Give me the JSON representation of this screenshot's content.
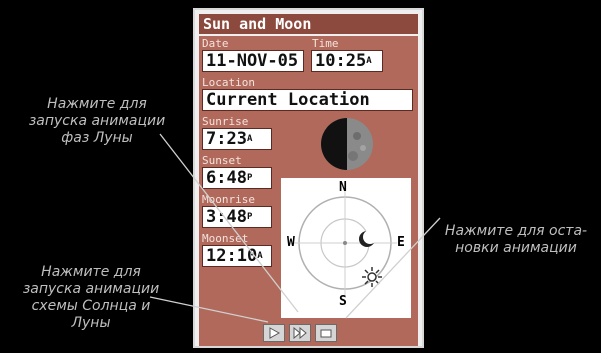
{
  "window": {
    "title": "Sun and Moon"
  },
  "fields": {
    "date_label": "Date",
    "date_value": "11-NOV-05",
    "time_label": "Time",
    "time_value": "10:25",
    "time_ampm": "A",
    "location_label": "Location",
    "location_value": "Current Location",
    "sunrise_label": "Sunrise",
    "sunrise_value": "7:23",
    "sunrise_ampm": "A",
    "sunset_label": "Sunset",
    "sunset_value": "6:48",
    "sunset_ampm": "P",
    "moonrise_label": "Moonrise",
    "moonrise_value": "3:48",
    "moonrise_ampm": "P",
    "moonset_label": "Moonset",
    "moonset_value": "12:10",
    "moonset_ampm": "A"
  },
  "compass": {
    "n": "N",
    "s": "S",
    "e": "E",
    "w": "W"
  },
  "buttons": {
    "play_icon": "play-icon",
    "fast_forward_icon": "fast-forward-icon",
    "stop_icon": "stop-icon"
  },
  "callouts": {
    "moon_phase_animation": "Нажмите для\nзапуска анимации\nфаз Луны",
    "stop_animation": "Нажмите для оста-\nновки анимации",
    "sun_moon_animation": "Нажмите для\nзапуска анимации\nсхемы Солнца и\nЛуны"
  },
  "colors": {
    "title_bar": "#8c4a3e",
    "panel": "#b0695a",
    "callout_text": "#bfbfbf"
  }
}
